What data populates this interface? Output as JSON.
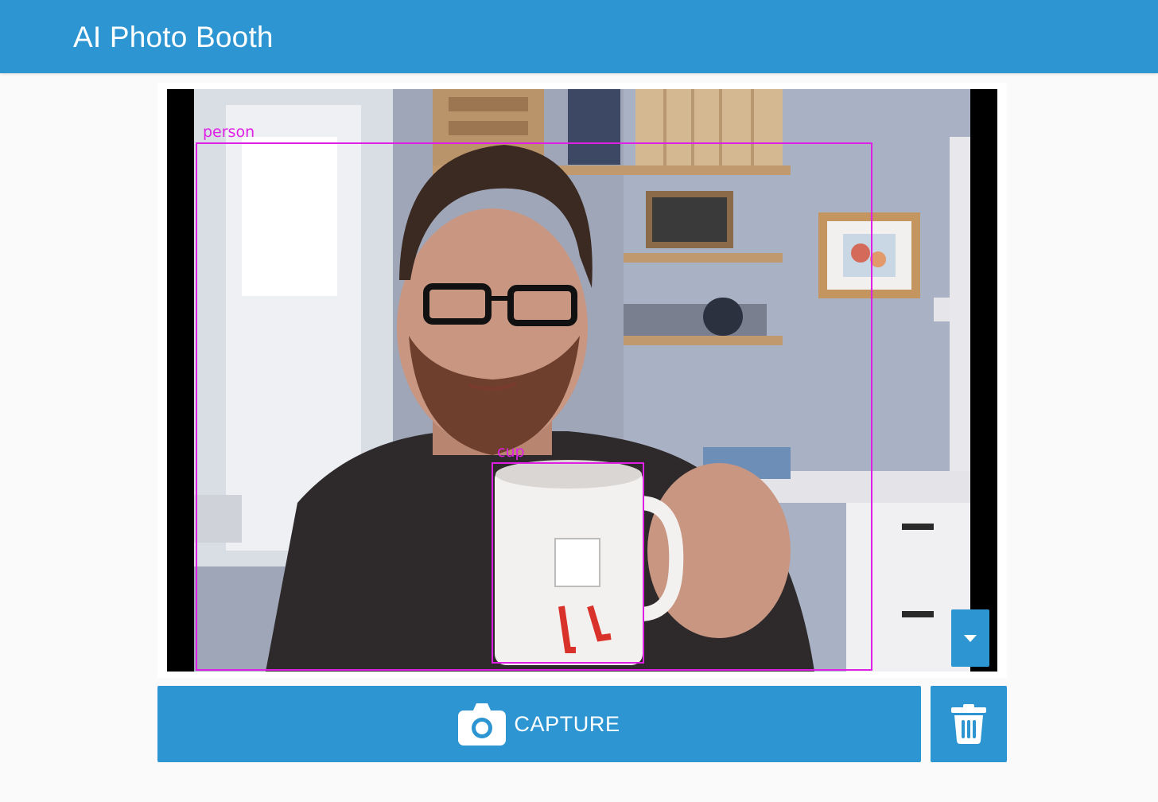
{
  "app_bar": {
    "title": "AI Photo Booth",
    "color": "#2d96d2"
  },
  "camera": {
    "detections": [
      {
        "label": "person",
        "color": "#e01fe6"
      },
      {
        "label": "cup",
        "color": "#e01fe6"
      }
    ],
    "menu_toggle_icon": "caret-down-icon"
  },
  "actions": {
    "capture_label": "CAPTURE",
    "capture_icon": "camera-icon",
    "delete_icon": "trash-icon"
  }
}
